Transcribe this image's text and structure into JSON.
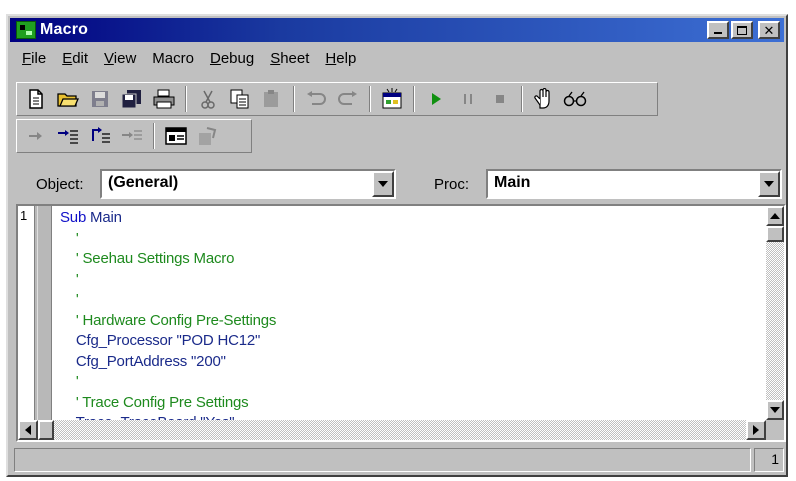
{
  "window": {
    "title": "Macro"
  },
  "menu": [
    {
      "label": "File",
      "key": "F",
      "rest": "ile"
    },
    {
      "label": "Edit",
      "key": "E",
      "rest": "dit"
    },
    {
      "label": "View",
      "key": "V",
      "rest": "iew"
    },
    {
      "label": "Macro",
      "key": "",
      "rest": "Macro"
    },
    {
      "label": "Debug",
      "key": "D",
      "rest": "ebug"
    },
    {
      "label": "Sheet",
      "key": "S",
      "rest": "heet"
    },
    {
      "label": "Help",
      "key": "H",
      "rest": "elp"
    }
  ],
  "toolbar1": [
    "new-file-icon",
    "open-folder-icon",
    "save-icon",
    "save-all-icon",
    "print-icon",
    "cut-icon",
    "copy-icon",
    "paste-icon",
    "undo-icon",
    "redo-icon",
    "dialog-editor-icon",
    "run-icon",
    "pause-icon",
    "stop-icon",
    "breakpoint-hand-icon",
    "quick-watch-icon"
  ],
  "toolbar2": [
    "step-icon",
    "step-into-icon",
    "step-over-icon",
    "step-out-icon",
    "browse-icon",
    "references-icon"
  ],
  "object": {
    "label": "Object:",
    "value": "(General)"
  },
  "proc": {
    "label": "Proc:",
    "value": "Main"
  },
  "editor": {
    "line_number": "1",
    "lines": [
      {
        "text": "Sub Main",
        "kind": "sub"
      },
      {
        "text": "    '",
        "kind": "comment"
      },
      {
        "text": "    ' Seehau Settings Macro",
        "kind": "comment"
      },
      {
        "text": "    '",
        "kind": "comment"
      },
      {
        "text": "    '",
        "kind": "comment"
      },
      {
        "text": "    ' Hardware Config Pre-Settings",
        "kind": "comment"
      },
      {
        "text": "    Cfg_Processor \"POD HC12\"",
        "kind": "code"
      },
      {
        "text": "    Cfg_PortAddress \"200\"",
        "kind": "code"
      },
      {
        "text": "    '",
        "kind": "comment"
      },
      {
        "text": "    ' Trace Config Pre Settings",
        "kind": "comment"
      },
      {
        "text": "    Trace_TraceBoard \"Yes\"",
        "kind": "code"
      }
    ]
  },
  "status": {
    "text": "",
    "line": "1"
  },
  "colors": {
    "keyword": "#1010c8",
    "comment": "#1e8a1e",
    "code": "#1a2a8a",
    "title_start": "#000080"
  }
}
